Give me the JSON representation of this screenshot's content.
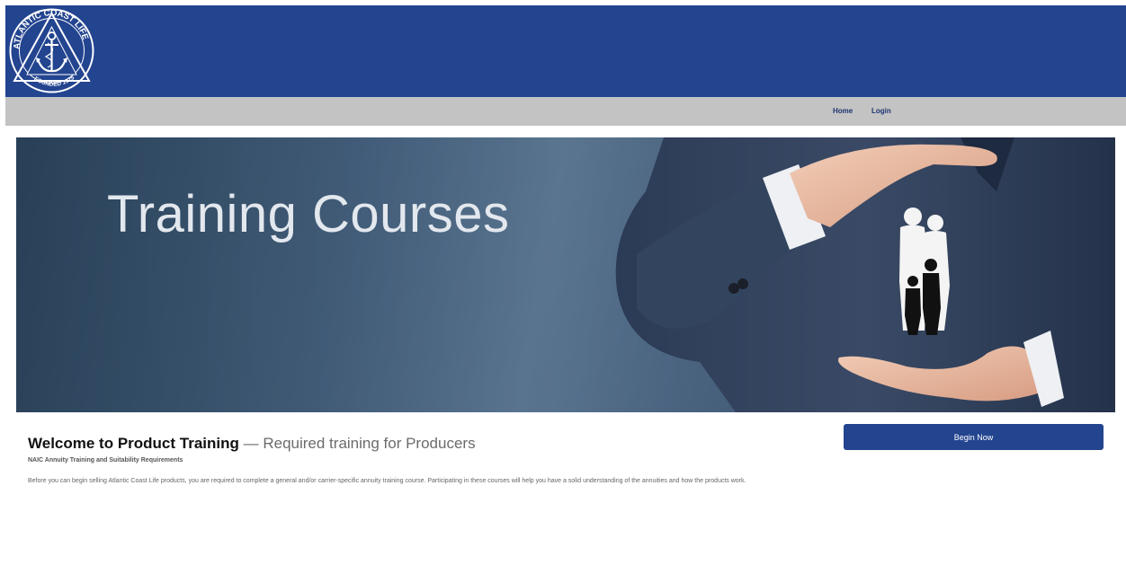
{
  "brand": {
    "logo_text_top": "ATLANTIC COAST LIFE",
    "logo_text_bottom": "FOUNDED 1925",
    "logo_icon": "anchor-icon",
    "header_color": "#23448f"
  },
  "nav": {
    "home_label": "Home",
    "login_label": "Login"
  },
  "hero": {
    "title": "Training Courses",
    "image": "businessman-hands-protecting-family-silhouette"
  },
  "content": {
    "welcome_title": "Welcome to Product Training",
    "welcome_separator": " — ",
    "welcome_subtitle": "Required training for Producers",
    "requirements_heading": "NAIC Annuity Training and Suitability Requirements",
    "description": "Before you can begin selling Atlantic Coast Life products, you are required to complete a general and/or carrier-specific annuity training course. Participating in these courses will help you have a solid understanding of the annuities and how the products work."
  },
  "cta": {
    "begin_label": "Begin Now"
  }
}
